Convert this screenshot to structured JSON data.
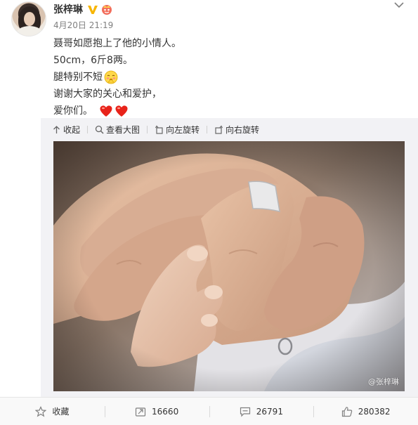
{
  "post": {
    "username": "张梓琳",
    "timestamp": "4月20日 21:19",
    "lines": {
      "l1": "聂哥如愿抱上了他的小情人。",
      "l2": "50cm，6斤8两。",
      "l3": "腿特别不短",
      "l4": "谢谢大家的关心和爱护，",
      "l5": "爱你们。"
    }
  },
  "media_toolbar": {
    "collapse_label": "收起",
    "view_large_label": "查看大图",
    "rotate_left_label": "向左旋转",
    "rotate_right_label": "向右旋转"
  },
  "photo": {
    "watermark": "@张梓琳"
  },
  "actions": {
    "favorite_label": "收藏",
    "repost_count": "16660",
    "comment_count": "26791",
    "like_count": "280382"
  },
  "icons": {
    "verified": "verified-v-icon",
    "vip": "vip-crown-icon",
    "more": "chevron-down-icon"
  },
  "colors": {
    "accent_orange": "#ff8200",
    "verified_yellow": "#f7b500",
    "heart_red": "#e8231a"
  }
}
